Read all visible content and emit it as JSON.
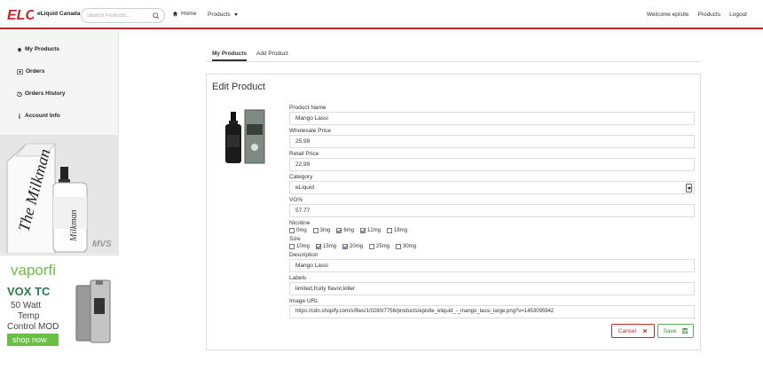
{
  "brand": {
    "name": "eLiquid Canada",
    "logo_text": "ELC"
  },
  "search": {
    "placeholder": "Search Products..."
  },
  "nav": {
    "home": "Home",
    "products": "Products",
    "welcome": "Welcome epistle",
    "products_link": "Products",
    "logout": "Logout"
  },
  "sidebar": {
    "items": [
      {
        "label": "My Products",
        "icon": "home-icon"
      },
      {
        "label": "Orders",
        "icon": "orders-icon"
      },
      {
        "label": "Orders History",
        "icon": "history-icon"
      },
      {
        "label": "Account Info",
        "icon": "info-icon"
      }
    ],
    "ad1": {
      "text": "The Milkman",
      "sub": "MVS"
    },
    "ad2": {
      "brand": "vaporfi",
      "line1": "VOX TC",
      "line2": "50 Watt",
      "line3": "Temp",
      "line4": "Control MOD",
      "cta": "shop now"
    }
  },
  "tabs": [
    {
      "label": "My Products"
    },
    {
      "label": "Add Product"
    }
  ],
  "form": {
    "title": "Edit Product",
    "product_name_label": "Product Name",
    "product_name": "Mango Lassi",
    "wholesale_label": "Wholesale Price",
    "wholesale": "25.99",
    "retail_label": "Retail Price",
    "retail": "22.99",
    "category_label": "Category",
    "category": "eLiquid",
    "vg_label": "VG%",
    "vg": "57.77",
    "nicotine_label": "Nicotine",
    "nicotine": [
      {
        "label": "0mg",
        "checked": false
      },
      {
        "label": "3mg",
        "checked": false
      },
      {
        "label": "6mg",
        "checked": true
      },
      {
        "label": "12mg",
        "checked": true
      },
      {
        "label": "18mg",
        "checked": false
      }
    ],
    "size_label": "Size",
    "sizes": [
      {
        "label": "10mg",
        "checked": false
      },
      {
        "label": "15mg",
        "checked": true
      },
      {
        "label": "20mg",
        "checked": true
      },
      {
        "label": "25mg",
        "checked": false
      },
      {
        "label": "30mg",
        "checked": false
      }
    ],
    "description_label": "Description",
    "description": "Mango Lassi",
    "labels_label": "Labels",
    "labels": "limited,fruity flavor,killer",
    "image_url_label": "Image URL",
    "image_url": "https://cdn.shopify.com/s/files/1/0280/7756/products/epistle_eliquid_-_mango_lassi_large.png?v=1453095942",
    "cancel": "Cancel",
    "save": "Save"
  },
  "colors": {
    "brand_red": "#c9252c",
    "save_green": "#3a8a3a",
    "vaporfi_green": "#6bbf44"
  }
}
